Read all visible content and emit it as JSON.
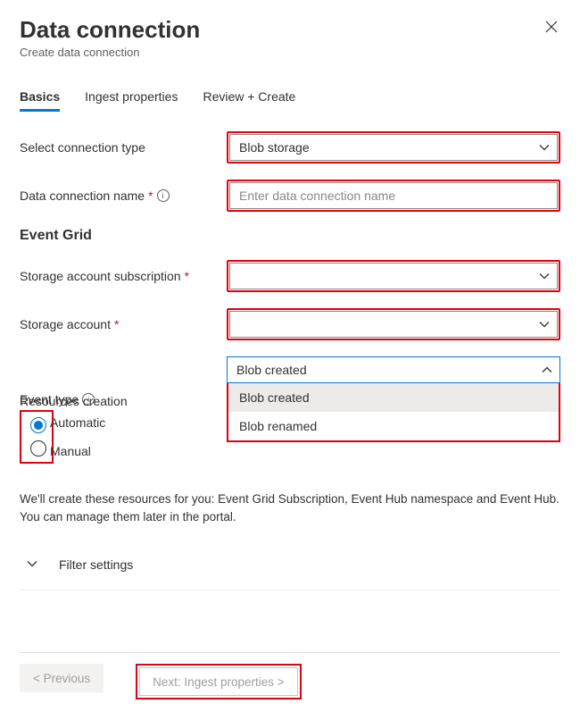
{
  "header": {
    "title": "Data connection",
    "subtitle": "Create data connection"
  },
  "tabs": {
    "basics": "Basics",
    "ingest": "Ingest properties",
    "review": "Review + Create"
  },
  "form": {
    "connection_type_label": "Select connection type",
    "connection_type_value": "Blob storage",
    "name_label": "Data connection name",
    "name_placeholder": "Enter data connection name",
    "section_event_grid": "Event Grid",
    "subscription_label": "Storage account subscription",
    "subscription_value": "",
    "storage_account_label": "Storage account",
    "storage_account_value": "",
    "event_type_label": "Event type",
    "event_type_value": "Blob created",
    "event_type_options": {
      "o0": "Blob created",
      "o1": "Blob renamed"
    },
    "resources_label": "Resources creation",
    "radio_auto": "Automatic",
    "radio_manual": "Manual",
    "help_text": "We'll create these resources for you: Event Grid Subscription, Event Hub namespace and Event Hub. You can manage them later in the portal.",
    "filter_settings": "Filter settings"
  },
  "footer": {
    "previous": "< Previous",
    "next": "Next: Ingest properties >"
  }
}
